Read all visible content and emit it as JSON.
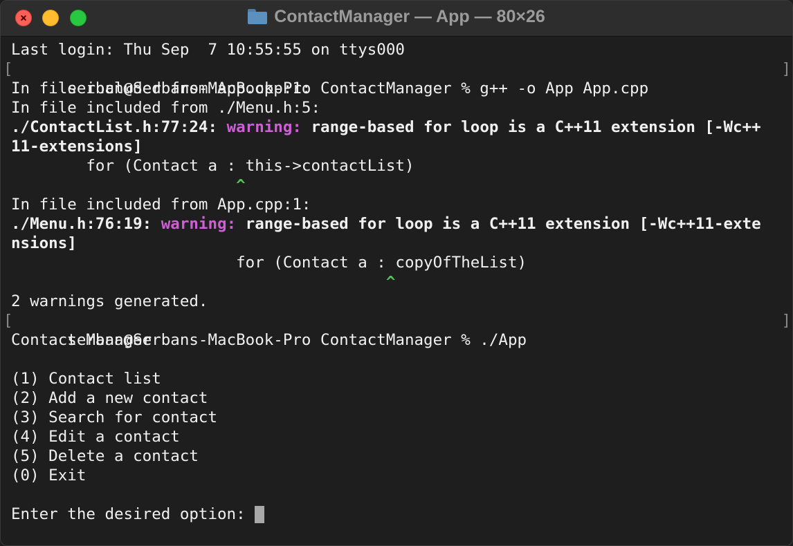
{
  "window": {
    "title": "ContactManager — App — 80×26",
    "folder_icon": "folder-icon",
    "colors": {
      "background": "#1e1e1e",
      "text": "#f0f0f0",
      "warning": "#d05ed6",
      "caret": "#52c452",
      "cursor": "#a8a8a8"
    }
  },
  "terminal": {
    "login": "Last login: Thu Sep  7 10:55:55 on ttys000",
    "prompt1": {
      "bracket_left": "[",
      "text": "serban@Serbans-MacBook-Pro ContactManager % g++ -o App App.cpp",
      "bracket_right": "]"
    },
    "included1": "In file included from App.cpp:1:",
    "included2": "In file included from ./Menu.h:5:",
    "warning1": {
      "location": "./ContactList.h:77:24: ",
      "label": "warning:",
      "message": " range-based for loop is a C++11 extension [-Wc++",
      "continuation": "11-extensions]",
      "code": "        for (Contact a : this->contactList)",
      "caret_pad": "                        ",
      "caret": "^"
    },
    "included3": "In file included from App.cpp:1:",
    "warning2": {
      "location": "./Menu.h:76:19: ",
      "label": "warning:",
      "message": " range-based for loop is a C++11 extension [-Wc++11-exte",
      "continuation": "nsions]",
      "code": "                        for (Contact a : copyOfTheList)",
      "caret_pad": "                                        ",
      "caret": "^"
    },
    "warnings_generated": "2 warnings generated.",
    "prompt2": {
      "bracket_left": "[",
      "text": "serban@Serbans-MacBook-Pro ContactManager % ./App",
      "bracket_right": "]"
    },
    "app_title": "Contact Manager",
    "menu": [
      "(1) Contact list",
      "(2) Add a new contact",
      "(3) Search for contact",
      "(4) Edit a contact",
      "(5) Delete a contact",
      "(0) Exit"
    ],
    "input_prompt": "Enter the desired option: "
  }
}
